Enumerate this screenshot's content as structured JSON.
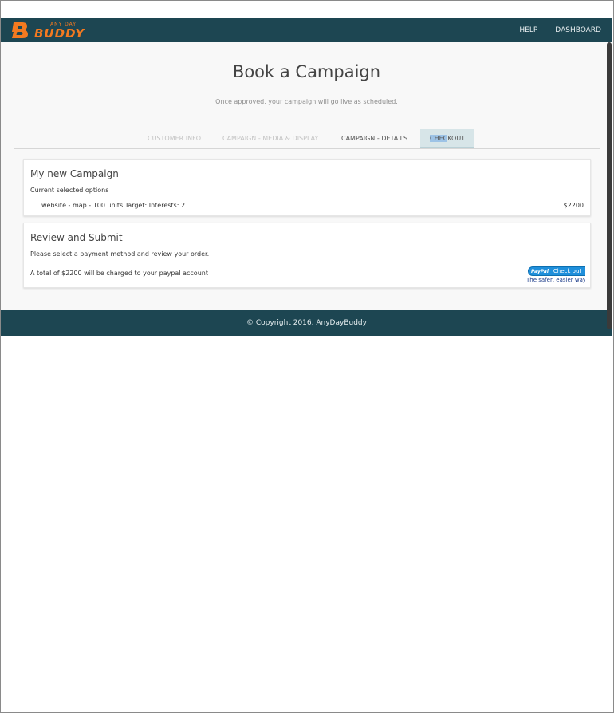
{
  "brand": {
    "small": "ANY DAY",
    "big": "BUDDY",
    "accent": "#f47a20",
    "navbar_color": "#1d4652"
  },
  "nav": {
    "help": "HELP",
    "dashboard": "DASHBOARD"
  },
  "page": {
    "title": "Book a Campaign",
    "subtitle": "Once approved, your campaign will go live as scheduled."
  },
  "tabs": [
    {
      "label": "CUSTOMER INFO",
      "state": "disabled"
    },
    {
      "label": "CAMPAIGN - MEDIA & DISPLAY",
      "state": "disabled"
    },
    {
      "label": "CAMPAIGN - DETAILS",
      "state": "enabled"
    },
    {
      "label_selected": "CHEC",
      "label_rest": "KOUT",
      "state": "active"
    }
  ],
  "campaign_card": {
    "title": "My new Campaign",
    "subtitle": "Current selected options",
    "item": {
      "description": "website - map - 100 units Target: Interests: 2",
      "price": "$2200"
    }
  },
  "review_card": {
    "title": "Review and Submit",
    "instruction": "Please select a payment method and review your order.",
    "total_text": "A total of $2200 will be charged to your paypal account",
    "paypal": {
      "logo": "PayPal",
      "button": "Check out",
      "tagline": "The safer, easier way to pay"
    }
  },
  "footer": {
    "text": "© Copyright 2016. AnyDayBuddy"
  }
}
